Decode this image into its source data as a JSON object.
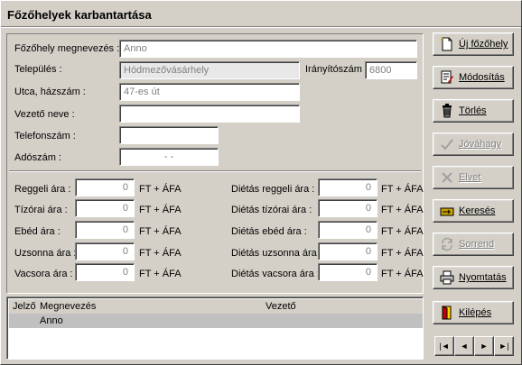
{
  "window": {
    "title": "Főzőhelyek karbantartása"
  },
  "form": {
    "name_label": "Főzőhely megnevezés :",
    "name_value": "Anno",
    "city_label": "Település :",
    "city_value": "Hódmezővásárhely",
    "zip_label": "Irányítószám :",
    "zip_value": "6800",
    "street_label": "Utca, házszám :",
    "street_value": "47-es út",
    "leader_label": "Vezető neve :",
    "leader_value": "",
    "phone_label": "Telefonszám :",
    "phone_value": "",
    "tax_label": "Adószám :",
    "tax_value": "-  -"
  },
  "prices": {
    "currency": "FT + ÁFA",
    "normal": [
      {
        "label": "Reggeli ára :",
        "value": "0"
      },
      {
        "label": "Tízórai ára :",
        "value": "0"
      },
      {
        "label": "Ebéd ára :",
        "value": "0"
      },
      {
        "label": "Uzsonna ára :",
        "value": "0"
      },
      {
        "label": "Vacsora ára :",
        "value": "0"
      }
    ],
    "diet": [
      {
        "label": "Diétás reggeli ára :",
        "value": "0"
      },
      {
        "label": "Diétás tízórai ára :",
        "value": "0"
      },
      {
        "label": "Diétás ebéd ára :",
        "value": "0"
      },
      {
        "label": "Diétás uzsonna ára :",
        "value": "0"
      },
      {
        "label": "Diétás vacsora ára :",
        "value": "0"
      }
    ]
  },
  "buttons": {
    "new": "Új főzőhely",
    "modify": "Módosítás",
    "delete": "Törlés",
    "approve": "Jóváhagy",
    "discard": "Elvet",
    "search": "Keresés",
    "order": "Sorrend",
    "print": "Nyomtatás",
    "exit": "Kilépés"
  },
  "grid": {
    "columns": [
      "Jelző",
      "Megnevezés",
      "Vezető"
    ],
    "rows": [
      {
        "flag": "",
        "name": "Anno",
        "leader": ""
      }
    ]
  },
  "nav": {
    "first": "|◄",
    "prev": "◄",
    "next": "►",
    "last": "►|"
  }
}
